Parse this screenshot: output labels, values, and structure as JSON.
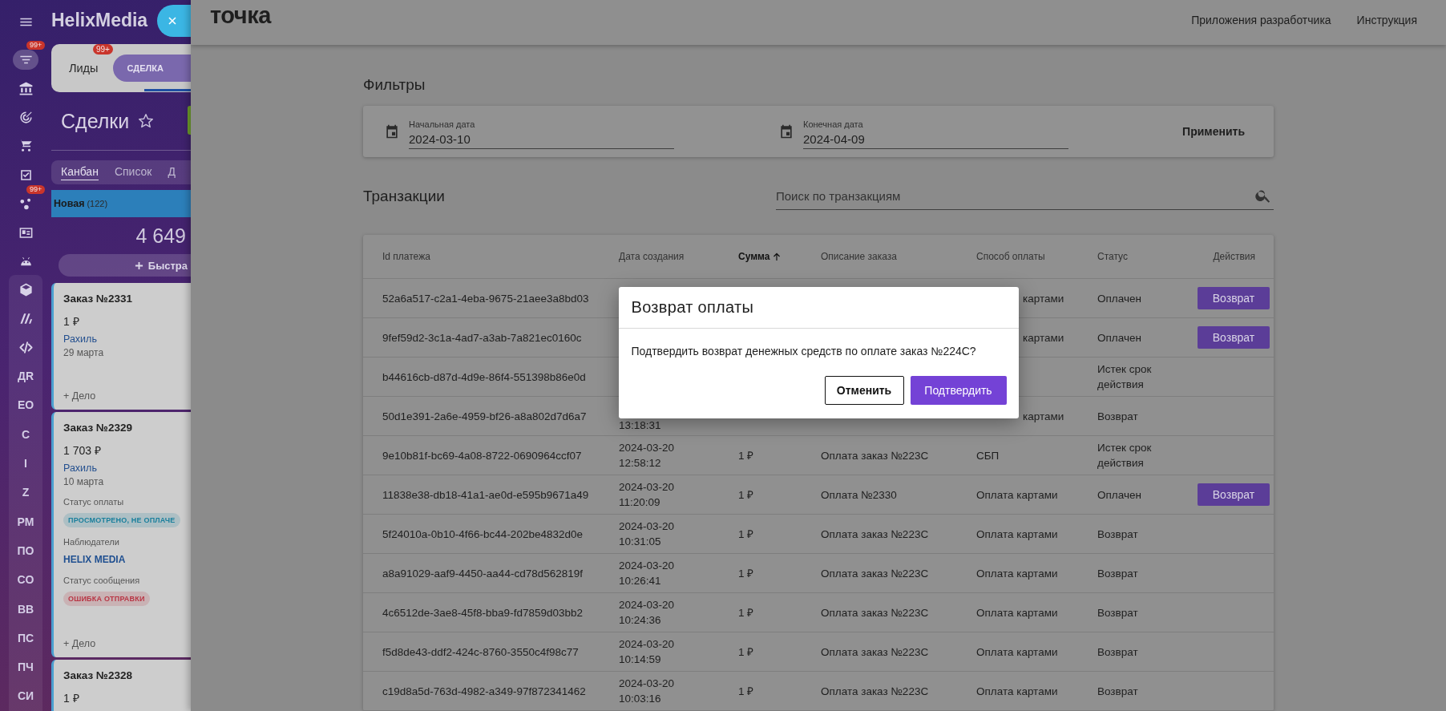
{
  "crm": {
    "rail": {
      "icons": [
        {
          "selected": true,
          "badge": "99+"
        },
        {
          "selected": false
        },
        {
          "selected": false
        },
        {
          "selected": false
        },
        {
          "selected": false
        },
        {
          "selected": false,
          "badge": "99+"
        },
        {
          "selected": false
        },
        {
          "selected": false
        }
      ],
      "group_icons": [
        {
          "selected": false
        },
        {
          "selected": false
        },
        {
          "selected": false
        }
      ],
      "text_items": [
        {
          "label": "ДR",
          "selected": false
        },
        {
          "label": "EO",
          "selected": false
        },
        {
          "label": "C",
          "selected": false
        },
        {
          "label": "I",
          "selected": false
        },
        {
          "label": "Z",
          "selected": false
        },
        {
          "label": "PM",
          "selected": false
        },
        {
          "label": "ПО",
          "selected": false
        },
        {
          "label": "CO",
          "selected": false
        },
        {
          "label": "BB",
          "selected": false
        },
        {
          "label": "ПС",
          "selected": false
        },
        {
          "label": "ПЧ",
          "selected": false
        },
        {
          "label": "СИ",
          "selected": false
        }
      ]
    },
    "app_title": "HelixMedia",
    "tabs": [
      {
        "label": "Лиды",
        "badge": "99+",
        "selected": false
      },
      {
        "label": "СДЕЛКА",
        "selected": true
      }
    ],
    "heading": "Сделки",
    "views": [
      {
        "label": "Канбан",
        "selected": true
      },
      {
        "label": "Список",
        "selected": false
      },
      {
        "label": "Д",
        "selected": false
      }
    ],
    "stage": {
      "name": "Новая",
      "count": "(122)",
      "total": "4 649",
      "quick_add": "Быстра"
    },
    "cards": [
      {
        "title": "Заказ №2331",
        "amount": "1 ₽",
        "contact": "Рахиль",
        "date": "29 марта",
        "add_task": "+ Дело"
      },
      {
        "title": "Заказ №2329",
        "amount": "1 703 ₽",
        "contact": "Рахиль",
        "date": "10 марта",
        "fields": [
          {
            "label": "Статус оплаты",
            "kind": "tag",
            "value": "ПРОСМОТРЕНО, НЕ ОПЛАЧЕ",
            "color": "#1a7f9c"
          },
          {
            "label": "Наблюдатели",
            "kind": "link",
            "value": "HELIX MEDIA"
          },
          {
            "label": "Статус сообщения",
            "kind": "tag",
            "value": "ОШИБКА ОТПРАВКИ",
            "color": "#b83544"
          }
        ],
        "add_task": "+ Дело"
      },
      {
        "title": "Заказ №2328",
        "amount": "1 ₽"
      }
    ]
  },
  "topbar": {
    "logo": "точка",
    "links": [
      "Приложения разработчика",
      "Инструкция"
    ]
  },
  "filters": {
    "title": "Фильтры",
    "fields": [
      {
        "label": "Начальная дата",
        "value": "2024-03-10"
      },
      {
        "label": "Конечная дата",
        "value": "2024-04-09"
      }
    ],
    "apply": "Применить"
  },
  "transactions": {
    "title": "Транзакции",
    "search": {
      "placeholder": "Поиск по транзакциям"
    },
    "columns": [
      {
        "label": "Id платежа",
        "sorted": false
      },
      {
        "label": "Дата создания",
        "sorted": false
      },
      {
        "label": "Сумма",
        "sorted": true
      },
      {
        "label": "Описание заказа",
        "sorted": false
      },
      {
        "label": "Способ оплаты",
        "sorted": false
      },
      {
        "label": "Статус",
        "sorted": false
      },
      {
        "label": "Действия",
        "sorted": false
      }
    ],
    "rows": [
      {
        "id": "52a6a517-c2a1-4eba-9675-21aee3a8bd03",
        "method": "картами",
        "method_cut": true,
        "status": "Оплачен",
        "action": "Возврат"
      },
      {
        "id": "9fef59d2-3c1a-4ad7-a3ab-7a821ec0160c",
        "method": "картами",
        "method_cut": true,
        "status": "Оплачен",
        "action": "Возврат"
      },
      {
        "id": "b44616cb-d87d-4d9e-86f4-551398b86e0d",
        "status": "Истек срок действия"
      },
      {
        "id": "50d1e391-2a6e-4959-bf26-a8a802d7d6a7",
        "time": "13:18:31",
        "method": "картами",
        "method_cut": true,
        "status": "Возврат"
      },
      {
        "id": "9e10b81f-bc69-4a08-8722-0690964ccf07",
        "date": "2024-03-20",
        "time": "12:58:12",
        "amount": "1 ₽",
        "description": "Оплата заказ №223С",
        "method": "СБП",
        "status": "Истек срок действия"
      },
      {
        "id": "11838e38-db18-41a1-ae0d-e595b9671a49",
        "date": "2024-03-20",
        "time": "11:20:09",
        "amount": "1 ₽",
        "description": "Оплата №2330",
        "method": "Оплата картами",
        "status": "Оплачен",
        "action": "Возврат"
      },
      {
        "id": "5f24010a-0b10-4f66-bc44-202be4832d0e",
        "date": "2024-03-20",
        "time": "10:31:05",
        "amount": "1 ₽",
        "description": "Оплата заказ №223С",
        "method": "Оплата картами",
        "status": "Возврат"
      },
      {
        "id": "a8a91029-aaf9-4450-aa44-cd78d562819f",
        "date": "2024-03-20",
        "time": "10:26:41",
        "amount": "1 ₽",
        "description": "Оплата заказ №223С",
        "method": "Оплата картами",
        "status": "Возврат"
      },
      {
        "id": "4c6512de-3ae8-45f8-bba9-fd7859d03bb2",
        "date": "2024-03-20",
        "time": "10:24:36",
        "amount": "1 ₽",
        "description": "Оплата заказ №223С",
        "method": "Оплата картами",
        "status": "Возврат"
      },
      {
        "id": "f5d8de43-ddf2-424c-8760-3550c4f98c77",
        "date": "2024-03-20",
        "time": "10:14:59",
        "amount": "1 ₽",
        "description": "Оплата заказ №223С",
        "method": "Оплата картами",
        "status": "Возврат"
      },
      {
        "id": "c19d8a5d-763d-4982-a349-97f872341462",
        "date": "2024-03-20",
        "time": "10:03:16",
        "amount": "1 ₽",
        "description": "Оплата заказ №223С",
        "method": "Оплата картами",
        "status": "Возврат"
      }
    ]
  },
  "dialog": {
    "title": "Возврат оплаты",
    "message": "Подтвердить возврат денежных средств по оплате заказ №224С?",
    "buttons": [
      {
        "label": "Отменить",
        "kind": "secondary"
      },
      {
        "label": "Подтвердить",
        "kind": "primary"
      }
    ]
  }
}
